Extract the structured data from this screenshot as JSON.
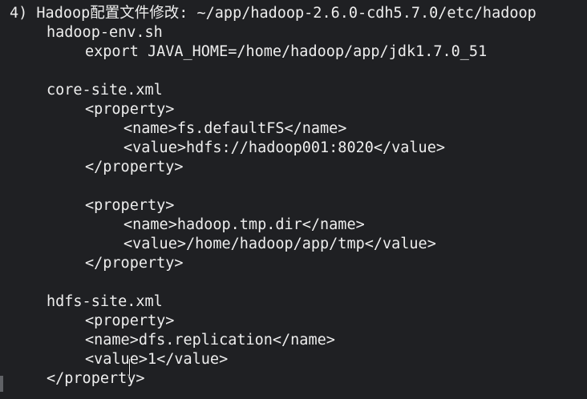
{
  "heading": "4) Hadoop配置文件修改: ~/app/hadoop-2.6.0-cdh5.7.0/etc/hadoop",
  "sections": {
    "hadoop_env": {
      "filename": "hadoop-env.sh",
      "export_line": "export JAVA_HOME=/home/hadoop/app/jdk1.7.0_51"
    },
    "core_site": {
      "filename": "core-site.xml",
      "prop1_open": "<property>",
      "prop1_name": "<name>fs.defaultFS</name>",
      "prop1_value": "<value>hdfs://hadoop001:8020</value>",
      "prop1_close": "</property>",
      "prop2_open": "<property>",
      "prop2_name": "<name>hadoop.tmp.dir</name>",
      "prop2_value": "<value>/home/hadoop/app/tmp</value>",
      "prop2_close": "</property>"
    },
    "hdfs_site": {
      "filename": "hdfs-site.xml",
      "prop_open": "<property>",
      "prop_name": "<name>dfs.replication</name>",
      "prop_value": "<value>1</value>",
      "prop_close": "</property>"
    }
  }
}
